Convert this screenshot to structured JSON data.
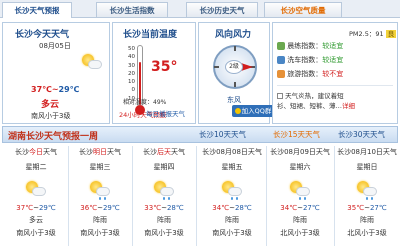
{
  "tabs": [
    "长沙天气预报",
    "长沙生活指数",
    "长沙历史天气",
    "长沙空气质量"
  ],
  "today": {
    "title": "长沙今天天气",
    "date": "08月05日",
    "temp_high": "37℃",
    "temp_sep": "~",
    "temp_low": "29℃",
    "desc": "多云",
    "wind": "南风小于3级"
  },
  "current": {
    "title": "长沙当前温度",
    "temperature": "35°",
    "scale": [
      "50",
      "40",
      "30",
      "20",
      "10",
      "0",
      "-10"
    ],
    "humidity": "相对湿度：49%",
    "forecast_link": "24小时天气预报",
    "level": 35,
    "scale_min": -10,
    "scale_max": 50
  },
  "wind": {
    "title": "风向风力",
    "level": "2级",
    "direction": "东风",
    "daily_link": "每日播报天气",
    "qq_button": "加入QQ群"
  },
  "aqi": {
    "label": "PM2.5：",
    "value": "91",
    "badge": "良"
  },
  "indices": [
    {
      "name": "晨练指数：",
      "value": "较适宜"
    },
    {
      "name": "洗车指数：",
      "value": "较适宜"
    },
    {
      "name": "旅游指数：",
      "value": "较不宜"
    }
  ],
  "warning": {
    "title": "天气炎热，建议着短",
    "subtitle": "衫、短裙、短裤、薄…",
    "more": "详细"
  },
  "week": {
    "title": "湖南长沙天气预报一周",
    "tabs": [
      "长沙10天天气",
      "长沙15天天气",
      "长沙30天天气"
    ],
    "days": [
      {
        "head_pre": "长沙",
        "head_hl": "今日",
        "head_post": "天气",
        "weekday": "星期二",
        "high": "37℃",
        "low": "29℃",
        "desc": "多云",
        "wind": "南风小于3级"
      },
      {
        "head_pre": "长沙",
        "head_hl": "明日",
        "head_post": "天气",
        "weekday": "星期三",
        "high": "36℃",
        "low": "29℃",
        "desc": "阵雨",
        "wind": "南风小于3级"
      },
      {
        "head_pre": "长沙",
        "head_hl": "后天",
        "head_post": "天气",
        "weekday": "星期四",
        "high": "33℃",
        "low": "28℃",
        "desc": "阵雨",
        "wind": "南风小于3级"
      },
      {
        "head_pre": "长沙08月08日天气",
        "head_hl": "",
        "head_post": "",
        "weekday": "星期五",
        "high": "34℃",
        "low": "28℃",
        "desc": "阵雨",
        "wind": "南风小于3级"
      },
      {
        "head_pre": "长沙08月09日天气",
        "head_hl": "",
        "head_post": "",
        "weekday": "星期六",
        "high": "34℃",
        "low": "27℃",
        "desc": "阵雨",
        "wind": "北风小于3级"
      },
      {
        "head_pre": "长沙08月10日天气",
        "head_hl": "",
        "head_post": "",
        "weekday": "星期日",
        "high": "35℃",
        "low": "27℃",
        "desc": "阵雨",
        "wind": "北风小于3级"
      }
    ]
  },
  "colors": {
    "accent": "#1f4e8c",
    "hot": "#d21e1e",
    "good": "#2f9a2f",
    "warn": "#e26a00"
  }
}
